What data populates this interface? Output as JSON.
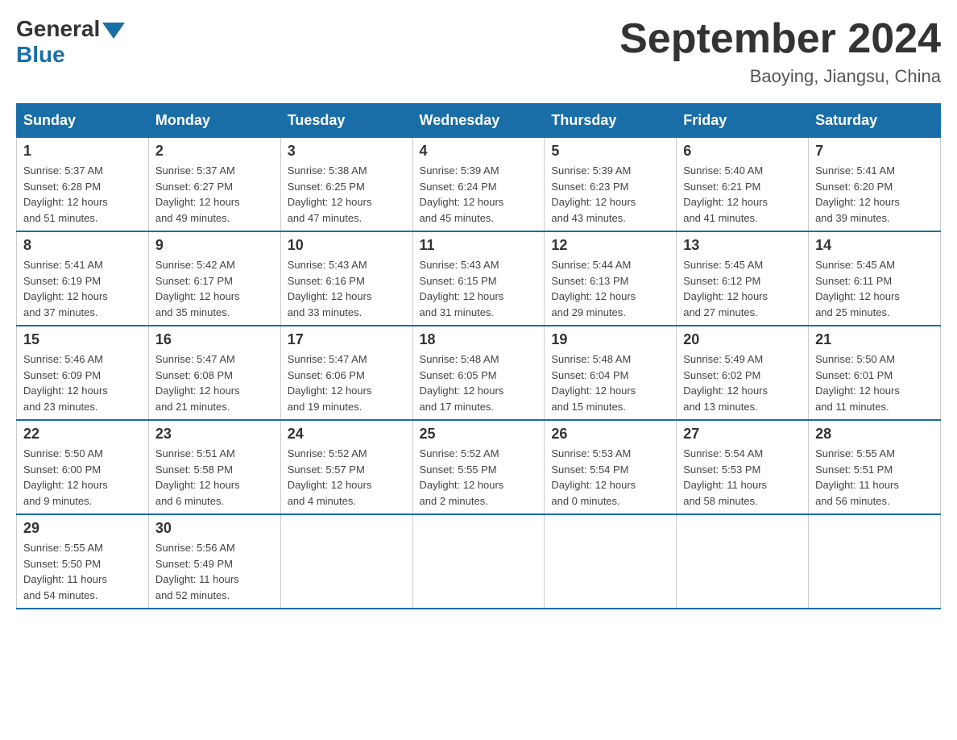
{
  "logo": {
    "general": "General",
    "blue": "Blue"
  },
  "title": "September 2024",
  "subtitle": "Baoying, Jiangsu, China",
  "days_of_week": [
    "Sunday",
    "Monday",
    "Tuesday",
    "Wednesday",
    "Thursday",
    "Friday",
    "Saturday"
  ],
  "weeks": [
    [
      {
        "day": "1",
        "sunrise": "5:37 AM",
        "sunset": "6:28 PM",
        "daylight": "12 hours and 51 minutes."
      },
      {
        "day": "2",
        "sunrise": "5:37 AM",
        "sunset": "6:27 PM",
        "daylight": "12 hours and 49 minutes."
      },
      {
        "day": "3",
        "sunrise": "5:38 AM",
        "sunset": "6:25 PM",
        "daylight": "12 hours and 47 minutes."
      },
      {
        "day": "4",
        "sunrise": "5:39 AM",
        "sunset": "6:24 PM",
        "daylight": "12 hours and 45 minutes."
      },
      {
        "day": "5",
        "sunrise": "5:39 AM",
        "sunset": "6:23 PM",
        "daylight": "12 hours and 43 minutes."
      },
      {
        "day": "6",
        "sunrise": "5:40 AM",
        "sunset": "6:21 PM",
        "daylight": "12 hours and 41 minutes."
      },
      {
        "day": "7",
        "sunrise": "5:41 AM",
        "sunset": "6:20 PM",
        "daylight": "12 hours and 39 minutes."
      }
    ],
    [
      {
        "day": "8",
        "sunrise": "5:41 AM",
        "sunset": "6:19 PM",
        "daylight": "12 hours and 37 minutes."
      },
      {
        "day": "9",
        "sunrise": "5:42 AM",
        "sunset": "6:17 PM",
        "daylight": "12 hours and 35 minutes."
      },
      {
        "day": "10",
        "sunrise": "5:43 AM",
        "sunset": "6:16 PM",
        "daylight": "12 hours and 33 minutes."
      },
      {
        "day": "11",
        "sunrise": "5:43 AM",
        "sunset": "6:15 PM",
        "daylight": "12 hours and 31 minutes."
      },
      {
        "day": "12",
        "sunrise": "5:44 AM",
        "sunset": "6:13 PM",
        "daylight": "12 hours and 29 minutes."
      },
      {
        "day": "13",
        "sunrise": "5:45 AM",
        "sunset": "6:12 PM",
        "daylight": "12 hours and 27 minutes."
      },
      {
        "day": "14",
        "sunrise": "5:45 AM",
        "sunset": "6:11 PM",
        "daylight": "12 hours and 25 minutes."
      }
    ],
    [
      {
        "day": "15",
        "sunrise": "5:46 AM",
        "sunset": "6:09 PM",
        "daylight": "12 hours and 23 minutes."
      },
      {
        "day": "16",
        "sunrise": "5:47 AM",
        "sunset": "6:08 PM",
        "daylight": "12 hours and 21 minutes."
      },
      {
        "day": "17",
        "sunrise": "5:47 AM",
        "sunset": "6:06 PM",
        "daylight": "12 hours and 19 minutes."
      },
      {
        "day": "18",
        "sunrise": "5:48 AM",
        "sunset": "6:05 PM",
        "daylight": "12 hours and 17 minutes."
      },
      {
        "day": "19",
        "sunrise": "5:48 AM",
        "sunset": "6:04 PM",
        "daylight": "12 hours and 15 minutes."
      },
      {
        "day": "20",
        "sunrise": "5:49 AM",
        "sunset": "6:02 PM",
        "daylight": "12 hours and 13 minutes."
      },
      {
        "day": "21",
        "sunrise": "5:50 AM",
        "sunset": "6:01 PM",
        "daylight": "12 hours and 11 minutes."
      }
    ],
    [
      {
        "day": "22",
        "sunrise": "5:50 AM",
        "sunset": "6:00 PM",
        "daylight": "12 hours and 9 minutes."
      },
      {
        "day": "23",
        "sunrise": "5:51 AM",
        "sunset": "5:58 PM",
        "daylight": "12 hours and 6 minutes."
      },
      {
        "day": "24",
        "sunrise": "5:52 AM",
        "sunset": "5:57 PM",
        "daylight": "12 hours and 4 minutes."
      },
      {
        "day": "25",
        "sunrise": "5:52 AM",
        "sunset": "5:55 PM",
        "daylight": "12 hours and 2 minutes."
      },
      {
        "day": "26",
        "sunrise": "5:53 AM",
        "sunset": "5:54 PM",
        "daylight": "12 hours and 0 minutes."
      },
      {
        "day": "27",
        "sunrise": "5:54 AM",
        "sunset": "5:53 PM",
        "daylight": "11 hours and 58 minutes."
      },
      {
        "day": "28",
        "sunrise": "5:55 AM",
        "sunset": "5:51 PM",
        "daylight": "11 hours and 56 minutes."
      }
    ],
    [
      {
        "day": "29",
        "sunrise": "5:55 AM",
        "sunset": "5:50 PM",
        "daylight": "11 hours and 54 minutes."
      },
      {
        "day": "30",
        "sunrise": "5:56 AM",
        "sunset": "5:49 PM",
        "daylight": "11 hours and 52 minutes."
      },
      null,
      null,
      null,
      null,
      null
    ]
  ]
}
